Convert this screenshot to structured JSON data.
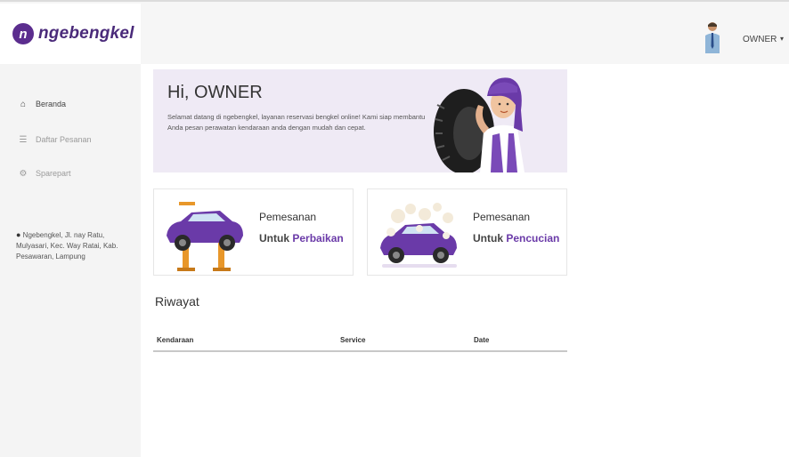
{
  "brand": {
    "mark": "n",
    "name": "ngebengkel"
  },
  "user": {
    "name": "OWNER",
    "caret": "▾"
  },
  "sidebar": {
    "items": [
      {
        "label": "Beranda",
        "icon": "home-icon",
        "glyph": "⌂",
        "active": true
      },
      {
        "label": "Daftar Pesanan",
        "icon": "list-icon",
        "glyph": "☰",
        "active": false
      },
      {
        "label": "Sparepart",
        "icon": "sparepart-icon",
        "glyph": "⚙",
        "active": false
      }
    ],
    "address": "Ngebengkel, Jl. nay Ratu, Mulyasari, Kec. Way Ratai, Kab. Pesawaran, Lampung"
  },
  "hero": {
    "title": "Hi, OWNER",
    "text": "Selamat datang di ngebengkel, layanan reservasi bengkel online! Kami siap membantu Anda pesan perawatan kendaraan anda dengan mudah dan cepat."
  },
  "cards": [
    {
      "line1": "Pemesanan",
      "prefix": "Untuk ",
      "accent": "Perbaikan"
    },
    {
      "line1": "Pemesanan",
      "prefix": "Untuk ",
      "accent": "Pencucian"
    }
  ],
  "riwayat": {
    "title": "Riwayat",
    "columns": [
      "Kendaraan",
      "Service",
      "Date"
    ]
  },
  "colors": {
    "brand": "#5b2d8e",
    "accent": "#6a3aa8",
    "hero_bg": "#efeaf5"
  }
}
